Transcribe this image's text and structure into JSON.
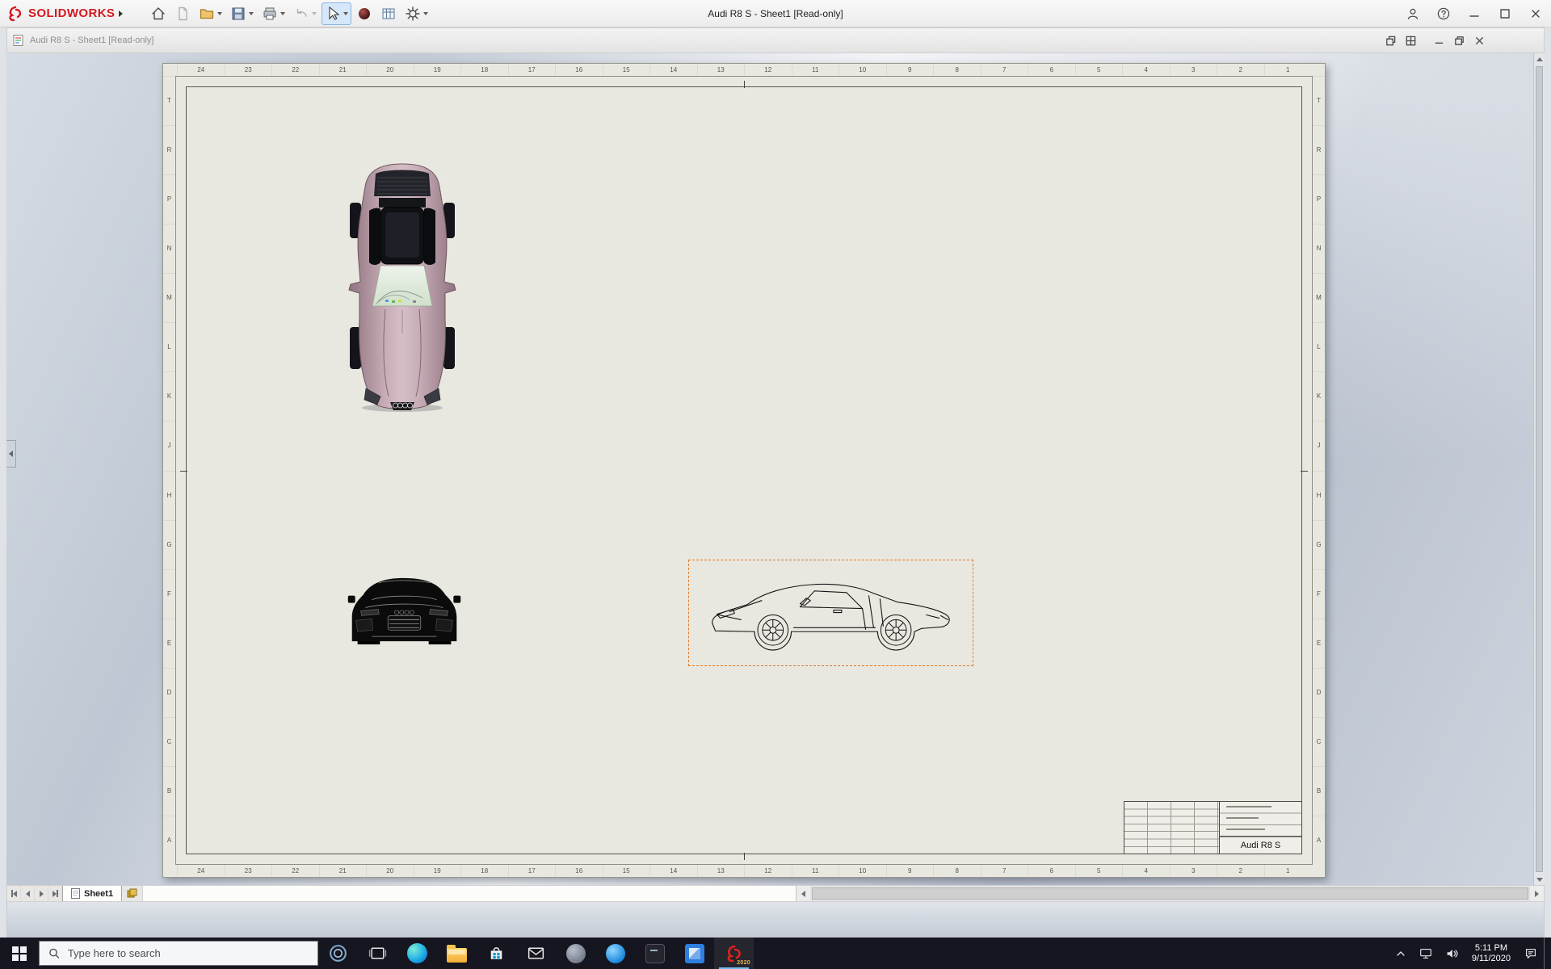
{
  "app": {
    "brand": "SOLIDWORKS",
    "title": "Audi R8 S - Sheet1 [Read-only]",
    "toolbar": [
      "home",
      "new-document",
      "open",
      "save",
      "print",
      "undo",
      "select",
      "render-sphere",
      "design-table",
      "options"
    ]
  },
  "doc": {
    "title": "Audi R8 S - Sheet1 [Read-only]"
  },
  "sheet": {
    "zones_h": [
      "24",
      "23",
      "22",
      "21",
      "20",
      "19",
      "18",
      "17",
      "16",
      "15",
      "14",
      "13",
      "12",
      "11",
      "10",
      "9",
      "8",
      "7",
      "6",
      "5",
      "4",
      "3",
      "2",
      "1"
    ],
    "zones_v": [
      "T",
      "R",
      "P",
      "N",
      "M",
      "L",
      "K",
      "J",
      "H",
      "G",
      "F",
      "E",
      "D",
      "C",
      "B",
      "A"
    ],
    "tab": "Sheet1",
    "title_block": {
      "part_name": "Audi R8 S"
    }
  },
  "taskbar": {
    "search_placeholder": "Type here to search",
    "clock": {
      "time": "5:11 PM",
      "date": "9/11/2020"
    },
    "solidworks_badge": "2020"
  },
  "colors": {
    "paper": "#e9e8e0",
    "selection_orange": "#e07b28",
    "car_body": "#c9aeb8",
    "brand_red": "#d41920",
    "taskbar_bg": "#15161f"
  }
}
